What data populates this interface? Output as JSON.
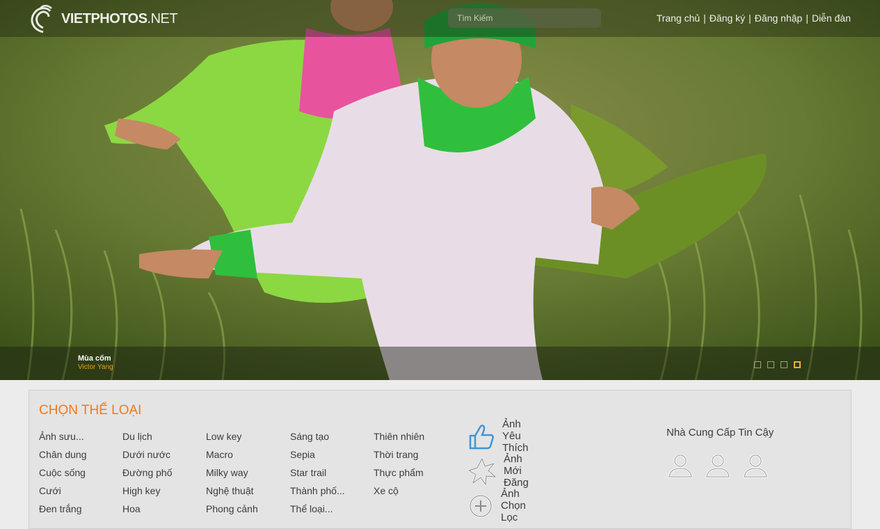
{
  "header": {
    "logo_text": "VIETPHOTOS",
    "logo_suffix": ".NET",
    "search_placeholder": "Tìm Kiếm",
    "nav": {
      "home": "Trang chủ",
      "register": "Đăng ký",
      "login": "Đăng nhập",
      "forum": "Diễn đàn",
      "separator": "|"
    }
  },
  "slideshow": {
    "caption_title": "Mùa cốm",
    "caption_author": "Victor Yang",
    "slide_count": 4,
    "active_slide": 4
  },
  "categories": {
    "title": "CHỌN THỂ LOẠI",
    "columns": [
      [
        "Ảnh sưu...",
        "Chân dung",
        "Cuộc sống",
        "Cưới",
        "Đen trắng"
      ],
      [
        "Du lịch",
        "Dưới nước",
        "Đường phố",
        "High key",
        "Hoa"
      ],
      [
        "Low key",
        "Macro",
        "Milky way",
        "Nghệ thuật",
        "Phong cảnh"
      ],
      [
        "Sáng tạo",
        "Sepia",
        "Star trail",
        "Thành phố...",
        "Thể loại..."
      ],
      [
        "Thiên nhiên",
        "Thời trang",
        "Thực phẩm",
        "Xe cộ"
      ]
    ]
  },
  "featured": {
    "liked": "Ảnh Yêu Thích",
    "new": "Ảnh Mới Đăng",
    "selected": "Ảnh Chọn Lọc"
  },
  "providers": {
    "title": "Nhà Cung Cấp Tin Cậy"
  },
  "colors": {
    "accent_orange": "#f07a17",
    "caption_author": "#e8a21d",
    "icon_blue": "#3f95d6"
  }
}
